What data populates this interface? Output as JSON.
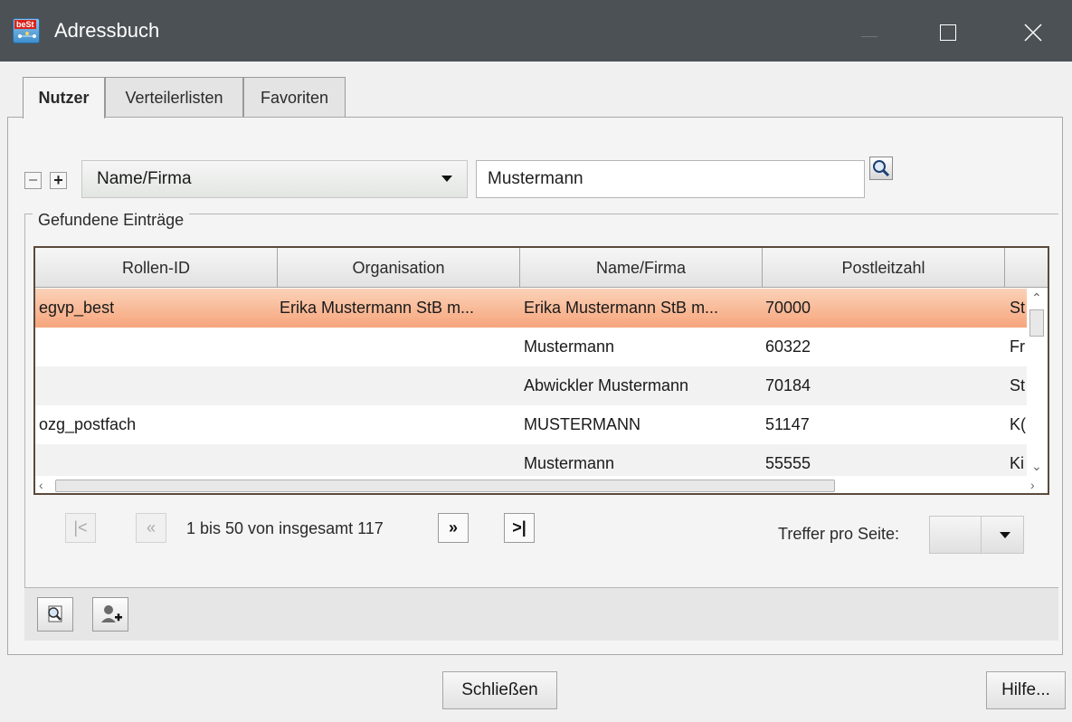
{
  "window": {
    "title": "Adressbuch",
    "icon_badge": "beSt",
    "controls": [
      "minimize-icon",
      "maximize-icon",
      "close-icon"
    ]
  },
  "tabs": [
    {
      "label": "Nutzer",
      "active": true
    },
    {
      "label": "Verteilerlisten",
      "active": false
    },
    {
      "label": "Favoriten",
      "active": false
    }
  ],
  "search": {
    "remove_label": "−",
    "add_label": "+",
    "field_selected": "Name/Firma",
    "value": "Mustermann",
    "search_icon": "search-icon"
  },
  "results": {
    "legend": "Gefundene Einträge",
    "columns": [
      "Rollen-ID",
      "Organisation",
      "Name/Firma",
      "Postleitzahl",
      ""
    ],
    "rows": [
      {
        "cells": [
          "egvp_best",
          "Erika Mustermann StB m...",
          "Erika Mustermann StB m...",
          "70000",
          "St"
        ],
        "selected": true
      },
      {
        "cells": [
          "",
          "",
          "Mustermann",
          "60322",
          "Fr"
        ],
        "selected": false
      },
      {
        "cells": [
          "",
          "",
          "Abwickler Mustermann",
          "70184",
          "St"
        ],
        "selected": false
      },
      {
        "cells": [
          "ozg_postfach",
          "",
          "MUSTERMANN",
          "51147",
          "K("
        ],
        "selected": false
      },
      {
        "cells": [
          "",
          "",
          "Mustermann",
          "55555",
          "Ki"
        ],
        "selected": false
      }
    ]
  },
  "pagination": {
    "first_label": "|<",
    "prev_label": "«",
    "status": "1 bis 50 von insgesamt 117",
    "next_label": "»",
    "last_label": ">|",
    "per_page_label": "Treffer pro Seite:",
    "per_page_value": ""
  },
  "toolbar": {
    "details_icon": "magnifier-document-icon",
    "add_user_icon": "add-user-icon"
  },
  "footer": {
    "close_label": "Schließen",
    "help_label": "Hilfe..."
  },
  "colors": {
    "titlebar": "#4b5155",
    "selected_row": "#f6a57c",
    "table_border": "#5a4a3a"
  }
}
